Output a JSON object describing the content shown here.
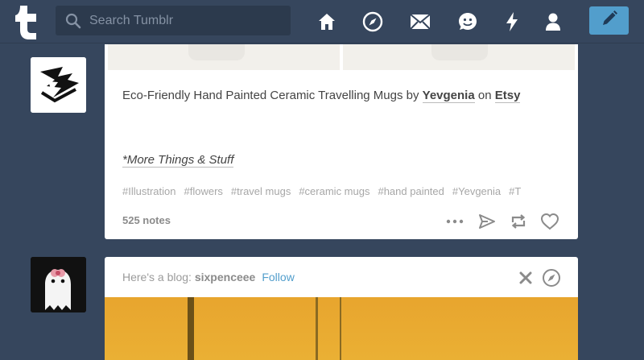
{
  "header": {
    "search_placeholder": "Search Tumblr",
    "nav": [
      "home-icon",
      "explore-icon",
      "inbox-icon",
      "messaging-icon",
      "activity-icon",
      "account-icon"
    ],
    "compose": "pencil-icon"
  },
  "post": {
    "caption": {
      "prefix": "Eco-Friendly Hand Painted Ceramic Travelling Mugs by ",
      "author": "Yevgenia",
      "middle": " on ",
      "store": "Etsy"
    },
    "more_link": "*More Things & Stuff",
    "tags": [
      "#Illustration",
      "#flowers",
      "#travel mugs",
      "#ceramic mugs",
      "#hand painted",
      "#Yevgenia",
      "#T"
    ],
    "notes": "525 notes",
    "actions": [
      "more-icon",
      "share-icon",
      "reblog-icon",
      "like-icon"
    ]
  },
  "recommendation": {
    "prefix": "Here's a blog: ",
    "blog": "sixpenceee",
    "follow": "Follow"
  },
  "colors": {
    "background": "#36465d",
    "accent": "#529ecc",
    "card": "#ffffff"
  }
}
